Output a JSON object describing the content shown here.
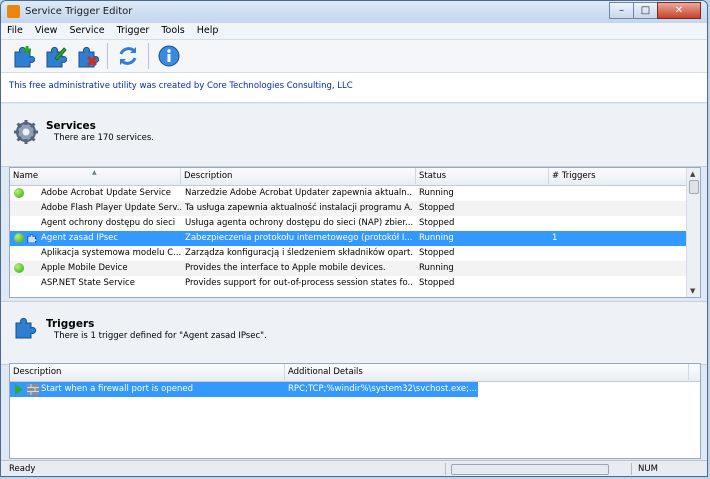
{
  "window": {
    "title": "Service Trigger Editor",
    "minimize": "–",
    "maximize": "□",
    "close": "✕"
  },
  "menu": [
    "File",
    "View",
    "Service",
    "Trigger",
    "Tools",
    "Help"
  ],
  "toolbar": {
    "buttons": [
      "add-trigger-icon",
      "edit-trigger-icon",
      "delete-trigger-icon",
      "refresh-icon",
      "info-icon"
    ]
  },
  "info_text": "This free administrative utility was created by Core Technologies Consulting, LLC",
  "services": {
    "title": "Services",
    "subtitle": "There are 170 services.",
    "columns": [
      "Name",
      "Description",
      "Status",
      "# Triggers"
    ],
    "rows": [
      {
        "name": "Adobe Acrobat Update Service",
        "description": "Narzedzie Adobe Acrobat Updater zapewnia aktualn...",
        "status": "Running",
        "triggers": "",
        "running": true
      },
      {
        "name": "Adobe Flash Player Update Serv...",
        "description": "Ta usługa zapewnia aktualność instalacji programu A...",
        "status": "Stopped",
        "triggers": "",
        "running": false
      },
      {
        "name": "Agent ochrony dostępu do sieci",
        "description": "Usługa agenta ochrony dostępu do sieci (NAP) zbier...",
        "status": "Stopped",
        "triggers": "",
        "running": false
      },
      {
        "name": "Agent zasad IPsec",
        "description": "Zabezpieczenia protokołu internetowego (protokół I...",
        "status": "Running",
        "triggers": "1",
        "running": true,
        "selected": true
      },
      {
        "name": "Aplikacja systemowa modelu C...",
        "description": "Zarządza konfiguracją i śledzeniem składników opart...",
        "status": "Stopped",
        "triggers": "",
        "running": false
      },
      {
        "name": "Apple Mobile Device",
        "description": "Provides the interface to Apple mobile devices.",
        "status": "Running",
        "triggers": "",
        "running": true
      },
      {
        "name": "ASP.NET State Service",
        "description": "Provides support for out-of-process session states fo...",
        "status": "Stopped",
        "triggers": "",
        "running": false
      }
    ]
  },
  "triggers": {
    "title": "Triggers",
    "subtitle": "There is 1 trigger defined for \"Agent zasad IPsec\".",
    "columns": [
      "Description",
      "Additional Details"
    ],
    "rows": [
      {
        "description": "Start when a firewall port is opened",
        "details": "RPC;TCP;%windir%\\system32\\svchost.exe;..."
      }
    ]
  },
  "status": {
    "left": "Ready",
    "right": "NUM"
  },
  "colors": {
    "selection": "#3399ff",
    "link": "#0a26b8"
  }
}
